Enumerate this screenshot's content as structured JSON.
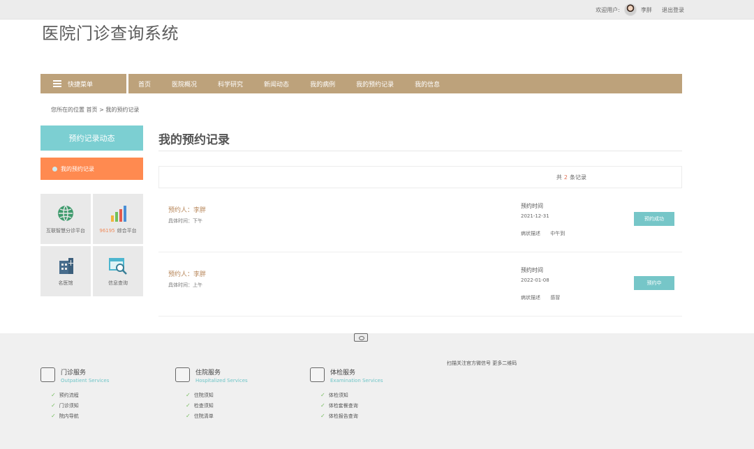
{
  "header": {
    "welcome": "欢迎用户:",
    "username": "李胖",
    "logout": "退出登录"
  },
  "site": {
    "title": "医院门诊查询系统"
  },
  "nav": {
    "quick_menu": "快捷菜单",
    "links": [
      "首页",
      "医院概况",
      "科学研究",
      "新闻动态",
      "我的病例",
      "我的预约记录",
      "我的信息"
    ]
  },
  "breadcrumb": "您所在的位置 首页 > 我的预约记录",
  "sidebar": {
    "header": "预约记录动态",
    "active_item": "我的预约记录",
    "tiles": [
      {
        "label": "互联智慧分诊平台",
        "icon": "globe-icon"
      },
      {
        "number": "96195",
        "label": "综合平台",
        "icon": "bar-chart-icon"
      },
      {
        "label": "名医馆",
        "icon": "hospital-building-icon"
      },
      {
        "label": "信息查询",
        "icon": "magnifier-window-icon"
      }
    ]
  },
  "main": {
    "title": "我的预约记录",
    "count_prefix": "共",
    "count": "2",
    "count_suffix": "条记录"
  },
  "records": [
    {
      "person": "预约人：李胖",
      "slot": "具体时间：下午",
      "time_label": "预约时间",
      "date": "2021-12-31",
      "desc_label": "病状描述",
      "desc": "中午到",
      "status": "预约成功"
    },
    {
      "person": "预约人：李胖",
      "slot": "具体时间：上午",
      "time_label": "预约时间",
      "date": "2022-01-08",
      "desc_label": "病状描述",
      "desc": "感冒",
      "status": "预约中"
    }
  ],
  "footer": {
    "columns": [
      {
        "title": "门诊服务",
        "en": "Outpatient Services",
        "items": [
          "预约流程",
          "门诊须知",
          "院内导航"
        ]
      },
      {
        "title": "住院服务",
        "en": "Hospitalized Services",
        "items": [
          "住院须知",
          "检查须知",
          "住院清单"
        ]
      },
      {
        "title": "体检服务",
        "en": "Examination Services",
        "items": [
          "体检须知",
          "体检套餐查询",
          "体检报告查询"
        ]
      }
    ],
    "qr_text": "扫描关注官方微信号 更多二维码"
  },
  "colors": {
    "nav_gold": "#bda27b",
    "teal": "#7ccfd2",
    "orange": "#ff8a50",
    "status_teal": "#76c6c8"
  }
}
